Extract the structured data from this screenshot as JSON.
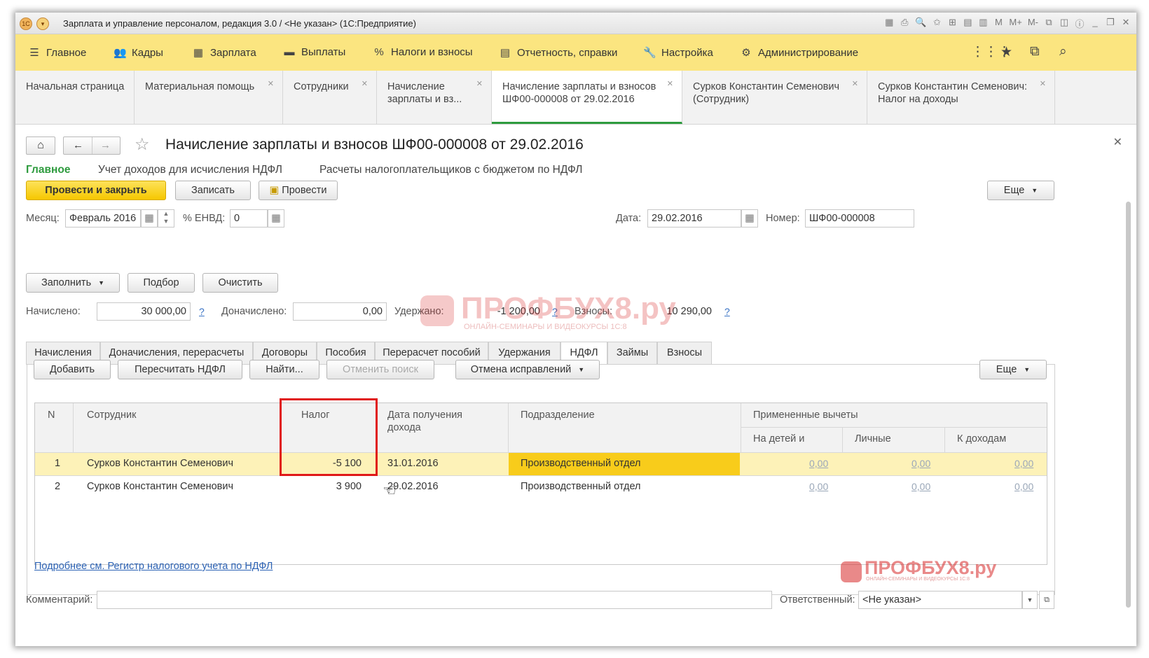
{
  "window": {
    "title": "Зарплата и управление персоналом, редакция 3.0 / <Не указан>  (1С:Предприятие)"
  },
  "titlebar_icons": [
    "М",
    "М+",
    "М-",
    "_",
    "❐",
    "✕"
  ],
  "menu": [
    {
      "label": "Главное",
      "icon": "hamburger-icon"
    },
    {
      "label": "Кадры",
      "icon": "people-icon"
    },
    {
      "label": "Зарплата",
      "icon": "calculator-icon"
    },
    {
      "label": "Выплаты",
      "icon": "money-icon"
    },
    {
      "label": "Налоги и взносы",
      "icon": "percent-icon"
    },
    {
      "label": "Отчетность, справки",
      "icon": "report-icon"
    },
    {
      "label": "Настройка",
      "icon": "wrench-icon"
    },
    {
      "label": "Администрирование",
      "icon": "gear-icon"
    }
  ],
  "open_tabs": [
    {
      "line1": "Начальная страница",
      "line2": ""
    },
    {
      "line1": "Материальная помощь",
      "line2": ""
    },
    {
      "line1": "Сотрудники",
      "line2": ""
    },
    {
      "line1": "Начисление",
      "line2": "зарплаты и вз..."
    },
    {
      "line1": "Начисление зарплаты и взносов",
      "line2": "ШФ00-000008 от 29.02.2016"
    },
    {
      "line1": "Сурков Константин Семенович",
      "line2": "(Сотрудник)"
    },
    {
      "line1": "Сурков Константин Семенович:",
      "line2": "Налог на доходы"
    }
  ],
  "document": {
    "title": "Начисление зарплаты и взносов ШФ00-000008 от 29.02.2016",
    "subnav": [
      "Главное",
      "Учет доходов для исчисления НДФЛ",
      "Расчеты налогоплательщиков с бюджетом по НДФЛ"
    ]
  },
  "commands": {
    "post_close": "Провести и закрыть",
    "save": "Записать",
    "post": "Провести",
    "more": "Еще"
  },
  "header_fields": {
    "month_label": "Месяц:",
    "month_value": "Февраль 2016",
    "envd_label": "% ЕНВД:",
    "envd_value": "0",
    "date_label": "Дата:",
    "date_value": "29.02.2016",
    "number_label": "Номер:",
    "number_value": "ШФ00-000008"
  },
  "fill_buttons": {
    "fill": "Заполнить",
    "pick": "Подбор",
    "clear": "Очистить"
  },
  "totals": {
    "accrued_label": "Начислено:",
    "accrued_value": "30 000,00",
    "extra_label": "Доначислено:",
    "extra_value": "0,00",
    "withheld_label": "Удержано:",
    "withheld_value": "-1 200,00",
    "contrib_label": "Взносы:",
    "contrib_value": "10 290,00",
    "help": "?"
  },
  "form_tabs": [
    "Начисления",
    "Доначисления, перерасчеты",
    "Договоры",
    "Пособия",
    "Перерасчет пособий",
    "Удержания",
    "НДФЛ",
    "Займы",
    "Взносы"
  ],
  "table_toolbar": {
    "add": "Добавить",
    "recalc": "Пересчитать НДФЛ",
    "find": "Найти...",
    "cancel_search": "Отменить поиск",
    "cancel_fix": "Отмена исправлений",
    "more": "Еще"
  },
  "table": {
    "headers": {
      "n": "N",
      "employee": "Сотрудник",
      "tax": "Налог",
      "date_line1": "Дата получения",
      "date_line2": "дохода",
      "dept": "Подразделение",
      "deductions": "Примененные вычеты",
      "children": "На детей и",
      "personal": "Личные",
      "income": "К доходам"
    },
    "rows": [
      {
        "n": "1",
        "employee": "Сурков Константин Семенович",
        "tax": "-5 100",
        "date": "31.01.2016",
        "dept": "Производственный отдел",
        "children": "0,00",
        "personal": "0,00",
        "income": "0,00"
      },
      {
        "n": "2",
        "employee": "Сурков Константин Семенович",
        "tax": "3 900",
        "date": "29.02.2016",
        "dept": "Производственный отдел",
        "children": "0,00",
        "personal": "0,00",
        "income": "0,00"
      }
    ]
  },
  "footer": {
    "register_link": "Подробнее см. Регистр налогового учета по НДФЛ",
    "comment_label": "Комментарий:",
    "comment_value": "",
    "responsible_label": "Ответственный:",
    "responsible_value": "<Не указан>"
  },
  "watermarks": {
    "main": "ПРОФБУХ8.ру",
    "sub": "ОНЛАЙН-СЕМИНАРЫ И ВИДЕОКУРСЫ 1С:8"
  },
  "colors": {
    "menu_bg": "#fbe580",
    "selected_row": "#fdf2b8",
    "selected_cell": "#f8cc1b",
    "accent_green": "#2e9b3e",
    "highlight_red": "#e01919"
  }
}
